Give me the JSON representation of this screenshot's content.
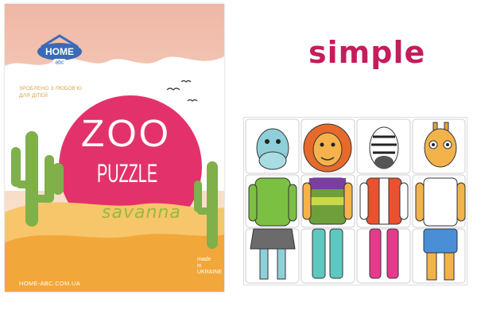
{
  "box": {
    "logo": {
      "top_text": "HOME",
      "bottom_text": "abc",
      "icon": "home-abc-logo"
    },
    "tagline_lines": [
      "ЗРОБЛЕНО З ЛЮБОВ'Ю",
      "ДЛЯ ДІТЕЙ"
    ],
    "title_line1": "ZOO",
    "title_line2": "PUZZLE",
    "subtitle": "savanna",
    "website": "HOME-ABC.COM.UA",
    "made_in_lines": [
      "made",
      "in",
      "ukraine"
    ],
    "colors": {
      "sky": "#f6d6b8",
      "circle": "#e3326b",
      "sand": "#f2a73a",
      "cactus": "#7fb04a"
    }
  },
  "label": {
    "text": "simple",
    "color": "#c51d5c"
  },
  "puzzle": {
    "grid": {
      "rows": 3,
      "columns": 4
    },
    "animals": [
      "hippo",
      "lion",
      "zebra",
      "giraffe"
    ]
  }
}
